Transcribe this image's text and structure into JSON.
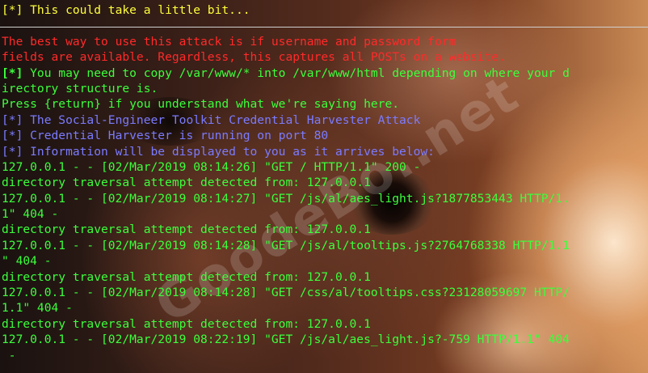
{
  "watermark": {
    "text": "GoodeBo..net"
  },
  "terminal": {
    "lines": [
      {
        "text": "[*] This could take a little bit...",
        "color": "yellow"
      },
      {
        "text": "",
        "color": "green"
      },
      {
        "text": "The best way to use this attack is if username and password form",
        "color": "red"
      },
      {
        "text": "fields are available. Regardless, this captures all POSTs on a website.",
        "color": "red"
      },
      {
        "prefix": "[*]",
        "text": " You may need to copy /var/www/* into /var/www/html depending on where your d",
        "color": "green"
      },
      {
        "text": "irectory structure is.",
        "color": "green"
      },
      {
        "text": "Press {return} if you understand what we're saying here.",
        "color": "green"
      },
      {
        "text": "[*] The Social-Engineer Toolkit Credential Harvester Attack",
        "color": "blue"
      },
      {
        "text": "[*] Credential Harvester is running on port 80",
        "color": "blue"
      },
      {
        "text": "[*] Information will be displayed to you as it arrives below:",
        "color": "blue"
      },
      {
        "text": "127.0.0.1 - - [02/Mar/2019 08:14:26] \"GET / HTTP/1.1\" 200 -",
        "color": "green"
      },
      {
        "text": "directory traversal attempt detected from: 127.0.0.1",
        "color": "green"
      },
      {
        "text": "127.0.0.1 - - [02/Mar/2019 08:14:27] \"GET /js/al/aes_light.js?1877853443 HTTP/1.",
        "color": "green"
      },
      {
        "text": "1\" 404 -",
        "color": "green"
      },
      {
        "text": "directory traversal attempt detected from: 127.0.0.1",
        "color": "green"
      },
      {
        "text": "127.0.0.1 - - [02/Mar/2019 08:14:28] \"GET /js/al/tooltips.js?2764768338 HTTP/1.1",
        "color": "green"
      },
      {
        "text": "\" 404 -",
        "color": "green"
      },
      {
        "text": "directory traversal attempt detected from: 127.0.0.1",
        "color": "green"
      },
      {
        "text": "127.0.0.1 - - [02/Mar/2019 08:14:28] \"GET /css/al/tooltips.css?23128059697 HTTP/",
        "color": "green"
      },
      {
        "text": "1.1\" 404 -",
        "color": "green"
      },
      {
        "text": "directory traversal attempt detected from: 127.0.0.1",
        "color": "green"
      },
      {
        "text": "127.0.0.1 - - [02/Mar/2019 08:22:19] \"GET /js/al/aes_light.js?-759 HTTP/1.1\" 404",
        "color": "green"
      },
      {
        "text": " -",
        "color": "green"
      }
    ]
  }
}
